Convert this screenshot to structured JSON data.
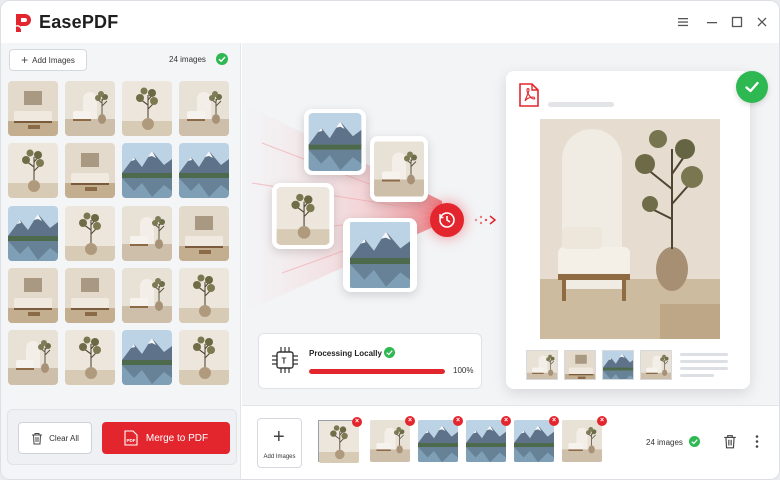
{
  "app": {
    "title": "EasePDF"
  },
  "left_panel": {
    "add_images_label": "Add Images",
    "image_count": "24 images",
    "clear_all_label": "Clear All",
    "merge_label": "Merge to PDF"
  },
  "processing": {
    "title": "Processing Locally",
    "progress_percent": 100,
    "progress_label": "100%"
  },
  "bottom_bar": {
    "add_images_label": "Add Images",
    "image_count": "24 images"
  },
  "colors": {
    "accent_red": "#e3262e",
    "success_green": "#2eb852",
    "panel_bg": "#f4f5f7"
  },
  "icons": {
    "logo": "easepdf-logo-icon",
    "menu": "hamburger-icon",
    "minimize": "minimize-icon",
    "maximize": "maximize-icon",
    "close": "close-icon",
    "check": "check-circle-icon",
    "trash": "trash-icon",
    "pdf": "pdf-file-icon",
    "clock": "clock-icon",
    "chip": "cpu-chip-icon",
    "more": "more-vertical-icon"
  }
}
